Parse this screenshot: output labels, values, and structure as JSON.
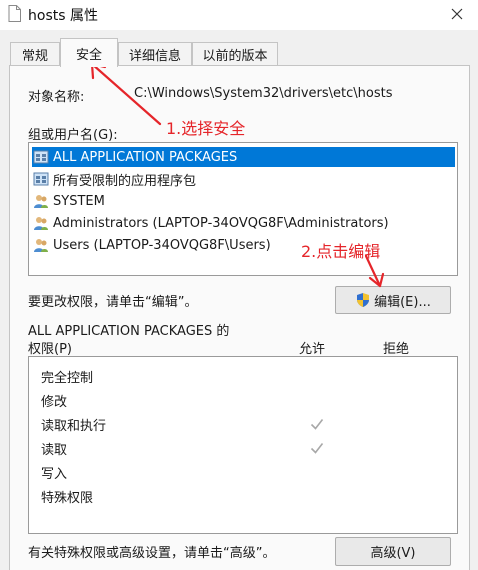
{
  "window": {
    "title": "hosts 属性"
  },
  "tabs": [
    {
      "label": "常规"
    },
    {
      "label": "安全"
    },
    {
      "label": "详细信息"
    },
    {
      "label": "以前的版本"
    }
  ],
  "object": {
    "label": "对象名称:",
    "value": "C:\\Windows\\System32\\drivers\\etc\\hosts"
  },
  "groups": {
    "label": "组或用户名(G):",
    "items": [
      {
        "label": "ALL APPLICATION PACKAGES",
        "icon": "app-package-icon"
      },
      {
        "label": "所有受限制的应用程序包",
        "icon": "app-package-icon"
      },
      {
        "label": "SYSTEM",
        "icon": "users-icon"
      },
      {
        "label": "Administrators (LAPTOP-34OVQG8F\\Administrators)",
        "icon": "users-icon"
      },
      {
        "label": "Users (LAPTOP-34OVQG8F\\Users)",
        "icon": "users-icon"
      }
    ]
  },
  "change_hint": "要更改权限，请单击“编辑”。",
  "edit_button": {
    "label": "编辑(E)...",
    "icon": "shield-icon"
  },
  "permissions": {
    "heading_line1": "ALL APPLICATION PACKAGES 的",
    "heading_line2": "权限(P)",
    "allow_header": "允许",
    "deny_header": "拒绝",
    "rows": [
      {
        "name": "完全控制",
        "allow": false,
        "deny": false
      },
      {
        "name": "修改",
        "allow": false,
        "deny": false
      },
      {
        "name": "读取和执行",
        "allow": true,
        "deny": false
      },
      {
        "name": "读取",
        "allow": true,
        "deny": false
      },
      {
        "name": "写入",
        "allow": false,
        "deny": false
      },
      {
        "name": "特殊权限",
        "allow": false,
        "deny": false
      }
    ]
  },
  "advanced_hint": "有关特殊权限或高级设置，请单击“高级”。",
  "advanced_button": {
    "label": "高级(V)"
  },
  "annotations": {
    "step1": "1.选择安全",
    "step2": "2.点击编辑"
  },
  "colors": {
    "selection": "#0078d7",
    "annotation": "#e5252a",
    "check": "#a8a8a8"
  }
}
